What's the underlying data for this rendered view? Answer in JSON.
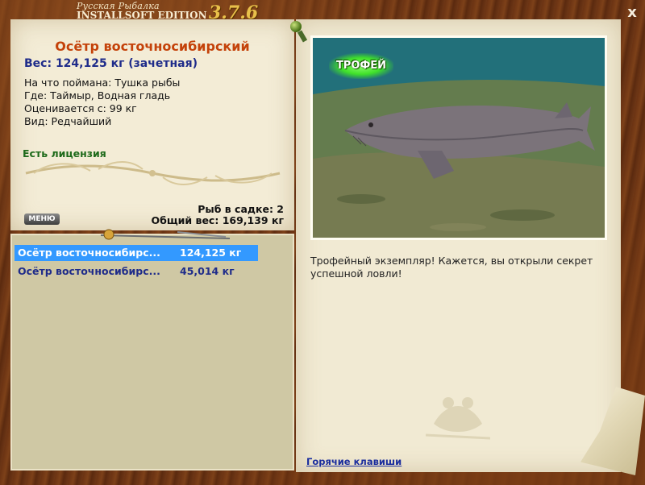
{
  "window": {
    "title_small": "Русская Рыбалка",
    "title_main": "INSTALLSOFT EDITION",
    "version": "3.7.6",
    "close_label": "x"
  },
  "fish": {
    "name": "Осётр восточносибирский",
    "weight": "Вес: 124,125 кг (зачетная)",
    "caught_with": "На что поймана: Тушка рыбы",
    "location": "Где: Таймыр, Водная гладь",
    "valued": "Оценивается с: 99 кг",
    "kind": "Вид: Редчайший",
    "license": "Есть лицензия"
  },
  "keepnet": {
    "count": "Рыб в садке: 2",
    "total": "Общий вес: 169,139 кг"
  },
  "menu_label": "МЕНЮ",
  "list": [
    {
      "name": "Осётр восточносибирс...",
      "weight": "124,125 кг"
    },
    {
      "name": "Осётр восточносибирс...",
      "weight": "45,014 кг"
    }
  ],
  "photo": {
    "badge": "ТРОФЕЙ"
  },
  "description": "Трофейный экземпляр! Кажется, вы открыли секрет успешной ловли!",
  "hotkeys": "Горячие клавиши",
  "colors": {
    "accent_name": "#c4420a",
    "weight_blue": "#1f2c8a",
    "license_green": "#1d6a1a",
    "selection": "#3399ff"
  }
}
